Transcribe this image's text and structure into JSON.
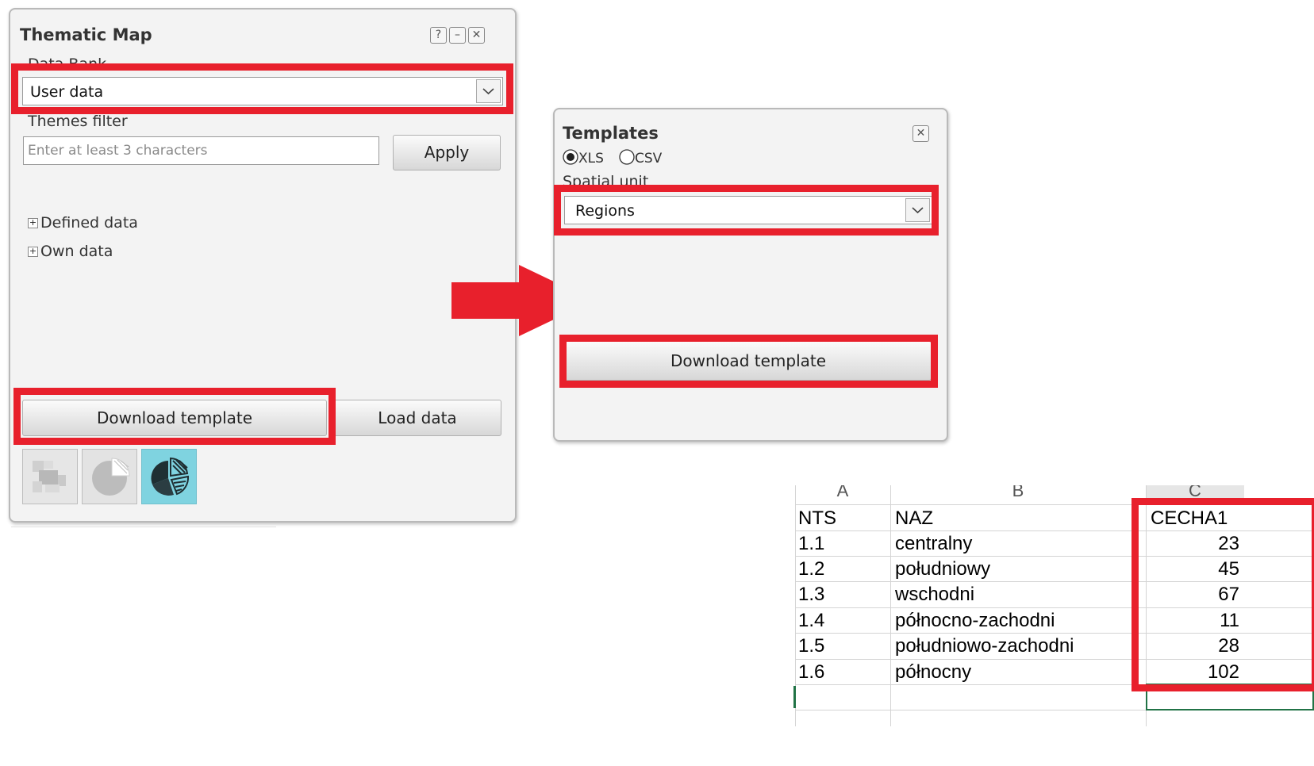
{
  "thematic_map": {
    "title": "Thematic Map",
    "window_buttons": {
      "help": "?",
      "minimize": "–",
      "close": "✕"
    },
    "data_bank_label": "Data Bank",
    "data_bank_value": "User data",
    "themes_filter_label": "Themes filter",
    "themes_filter_placeholder": "Enter at least 3 characters",
    "apply_label": "Apply",
    "tree_items": [
      {
        "label": "Defined data"
      },
      {
        "label": "Own data"
      }
    ],
    "download_label": "Download template",
    "load_label": "Load data",
    "icons": [
      "choropleth-icon",
      "pie-chart-icon",
      "hatched-pie-chart-icon"
    ]
  },
  "templates": {
    "title": "Templates",
    "close": "✕",
    "formats": [
      "XLS",
      "CSV"
    ],
    "selected_format": "XLS",
    "spatial_unit_label": "Spatial unit",
    "spatial_unit_value": "Regions",
    "download_label": "Download template"
  },
  "spreadsheet": {
    "column_letters": [
      "A",
      "B",
      "C"
    ],
    "headers": [
      "NTS",
      "NAZ",
      "CECHA1"
    ],
    "rows": [
      [
        "1.1",
        "centralny",
        "23"
      ],
      [
        "1.2",
        "południowy",
        "45"
      ],
      [
        "1.3",
        "wschodni",
        "67"
      ],
      [
        "1.4",
        "północno-zachodni",
        "11"
      ],
      [
        "1.5",
        "południowo-zachodni",
        "28"
      ],
      [
        "1.6",
        "północny",
        "102"
      ]
    ]
  },
  "colors": {
    "highlight": "#e8202c",
    "selected_icon_bg": "#7fd3e0"
  }
}
